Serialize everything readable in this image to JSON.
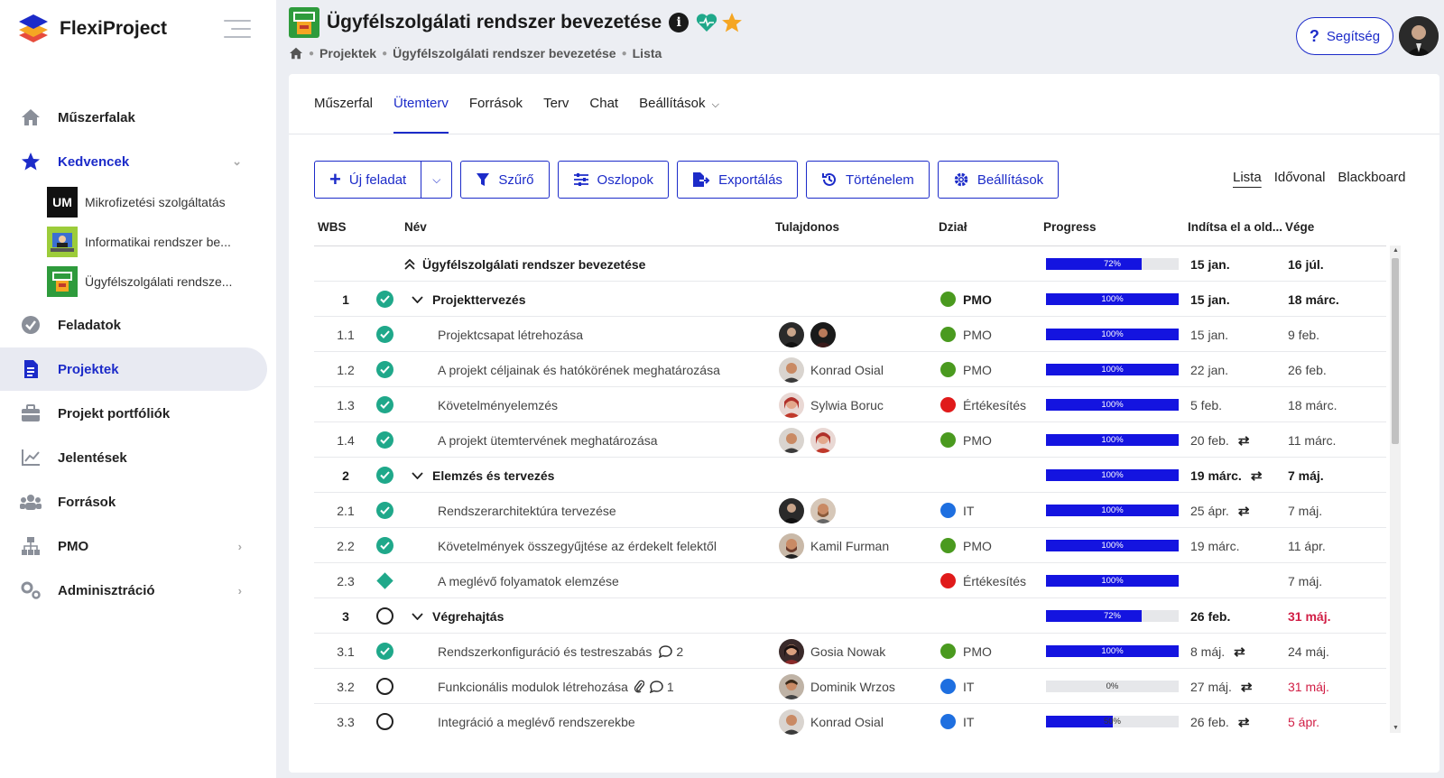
{
  "app": {
    "name": "FlexiProject"
  },
  "sidebar": {
    "items": [
      {
        "label": "Műszerfalak",
        "icon": "home-icon"
      },
      {
        "label": "Kedvencek",
        "icon": "star-icon"
      },
      {
        "label": "Feladatok",
        "icon": "check-circle-icon"
      },
      {
        "label": "Projektek",
        "icon": "document-icon"
      },
      {
        "label": "Projekt portfóliók",
        "icon": "briefcase-icon"
      },
      {
        "label": "Jelentések",
        "icon": "chart-line-icon"
      },
      {
        "label": "Források",
        "icon": "people-icon"
      },
      {
        "label": "PMO",
        "icon": "org-chart-icon"
      },
      {
        "label": "Adminisztráció",
        "icon": "gears-icon"
      }
    ],
    "favorites": [
      {
        "label": "Mikrofizetési szolgáltatás",
        "thumb": "UM"
      },
      {
        "label": "Informatikai rendszer be...",
        "thumb": ""
      },
      {
        "label": "Ügyfélszolgálati rendsze...",
        "thumb": ""
      }
    ]
  },
  "header": {
    "title": "Ügyfélszolgálati rendszer bevezetése",
    "breadcrumb": [
      "Projektek",
      "Ügyfélszolgálati rendszer bevezetése",
      "Lista"
    ],
    "help_label": "Segítség"
  },
  "tabs": [
    "Műszerfal",
    "Ütemterv",
    "Források",
    "Terv",
    "Chat",
    "Beállítások"
  ],
  "active_tab": "Ütemterv",
  "toolbar": {
    "new_task": "Új feladat",
    "filter": "Szűrő",
    "columns": "Oszlopok",
    "export": "Exportálás",
    "history": "Történelem",
    "settings": "Beállítások"
  },
  "views": [
    "Lista",
    "Idővonal",
    "Blackboard"
  ],
  "table": {
    "headers": {
      "wbs": "WBS",
      "name": "Név",
      "owner": "Tulajdonos",
      "dept": "Dział",
      "progress": "Progress",
      "start": "Indítsa el a old...",
      "end": "Vége"
    },
    "rows": [
      {
        "wbs": "",
        "status": "none",
        "name": "Ügyfélszolgálati rendszer bevezetése",
        "level": 0,
        "owner": "",
        "dept": "",
        "progress": 72,
        "progress_label": "72%",
        "start": "15 jan.",
        "end": "16 júl."
      },
      {
        "wbs": "1",
        "status": "done",
        "name": "Projekttervezés",
        "level": 1,
        "owner": "",
        "dept": "PMO",
        "progress": 100,
        "progress_label": "100%",
        "start": "15 jan.",
        "end": "18 márc."
      },
      {
        "wbs": "1.1",
        "status": "done",
        "name": "Projektcsapat létrehozása",
        "level": 2,
        "owner": "",
        "dept": "PMO",
        "progress": 100,
        "progress_label": "100%",
        "start": "15 jan.",
        "end": "9 feb."
      },
      {
        "wbs": "1.2",
        "status": "done",
        "name": "A projekt céljainak és hatókörének meghatározása",
        "level": 2,
        "owner": "Konrad Osial",
        "dept": "PMO",
        "progress": 100,
        "progress_label": "100%",
        "start": "22 jan.",
        "end": "26 feb."
      },
      {
        "wbs": "1.3",
        "status": "done",
        "name": "Követelményelemzés",
        "level": 2,
        "owner": "Sylwia Boruc",
        "dept": "Értékesítés",
        "progress": 100,
        "progress_label": "100%",
        "start": "5 feb.",
        "end": "18 márc."
      },
      {
        "wbs": "1.4",
        "status": "done",
        "name": "A projekt ütemtervének meghatározása",
        "level": 2,
        "owner": "",
        "dept": "PMO",
        "progress": 100,
        "progress_label": "100%",
        "start": "20 feb.",
        "end": "11 márc."
      },
      {
        "wbs": "2",
        "status": "done",
        "name": "Elemzés és tervezés",
        "level": 1,
        "owner": "",
        "dept": "",
        "progress": 100,
        "progress_label": "100%",
        "start": "19 márc.",
        "end": "7 máj."
      },
      {
        "wbs": "2.1",
        "status": "done",
        "name": "Rendszerarchitektúra tervezése",
        "level": 2,
        "owner": "",
        "dept": "IT",
        "progress": 100,
        "progress_label": "100%",
        "start": "25 ápr.",
        "end": "7 máj."
      },
      {
        "wbs": "2.2",
        "status": "done",
        "name": "Követelmények összegyűjtése az érdekelt felektől",
        "level": 2,
        "owner": "Kamil Furman",
        "dept": "PMO",
        "progress": 100,
        "progress_label": "100%",
        "start": "19 márc.",
        "end": "11 ápr."
      },
      {
        "wbs": "2.3",
        "status": "milestone",
        "name": "A meglévő folyamatok elemzése",
        "level": 2,
        "owner": "",
        "dept": "Értékesítés",
        "progress": 100,
        "progress_label": "100%",
        "start": "",
        "end": "7 máj."
      },
      {
        "wbs": "3",
        "status": "open",
        "name": "Végrehajtás",
        "level": 1,
        "owner": "",
        "dept": "",
        "progress": 72,
        "progress_label": "72%",
        "start": "26 feb.",
        "end": "31 máj."
      },
      {
        "wbs": "3.1",
        "status": "done",
        "name": "Rendszerkonfiguráció és testreszabás",
        "level": 2,
        "comments": "2",
        "owner": "Gosia Nowak",
        "dept": "PMO",
        "progress": 100,
        "progress_label": "100%",
        "start": "8 máj.",
        "end": "24 máj."
      },
      {
        "wbs": "3.2",
        "status": "open",
        "name": "Funkcionális modulok létrehozása",
        "level": 2,
        "comments": "1",
        "owner": "Dominik Wrzos",
        "dept": "IT",
        "progress": 0,
        "progress_label": "0%",
        "start": "27 máj.",
        "end": "31 máj."
      },
      {
        "wbs": "3.3",
        "status": "open",
        "name": "Integráció a meglévő rendszerekbe",
        "level": 2,
        "owner": "Konrad Osial",
        "dept": "IT",
        "progress": 50,
        "progress_label": "50%",
        "start": "26 feb.",
        "end": "5 ápr."
      }
    ]
  },
  "colors": {
    "accent": "#1c2bc9",
    "progress": "#1414e0",
    "done": "#1fa88a",
    "pmo": "#4a9a1f",
    "it": "#1e6fe0",
    "sales": "#e01a1a",
    "overdue": "#d11e45"
  }
}
